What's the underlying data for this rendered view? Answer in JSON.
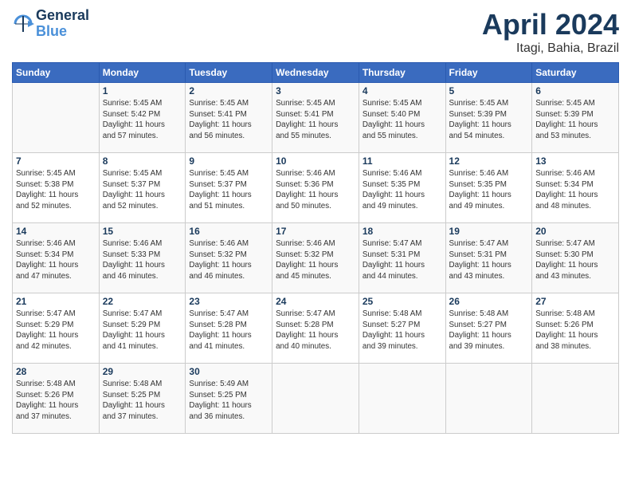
{
  "header": {
    "logo_line1": "General",
    "logo_line2": "Blue",
    "title": "April 2024",
    "subtitle": "Itagi, Bahia, Brazil"
  },
  "calendar": {
    "days_of_week": [
      "Sunday",
      "Monday",
      "Tuesday",
      "Wednesday",
      "Thursday",
      "Friday",
      "Saturday"
    ],
    "weeks": [
      [
        {
          "day": "",
          "info": ""
        },
        {
          "day": "1",
          "info": "Sunrise: 5:45 AM\nSunset: 5:42 PM\nDaylight: 11 hours\nand 57 minutes."
        },
        {
          "day": "2",
          "info": "Sunrise: 5:45 AM\nSunset: 5:41 PM\nDaylight: 11 hours\nand 56 minutes."
        },
        {
          "day": "3",
          "info": "Sunrise: 5:45 AM\nSunset: 5:41 PM\nDaylight: 11 hours\nand 55 minutes."
        },
        {
          "day": "4",
          "info": "Sunrise: 5:45 AM\nSunset: 5:40 PM\nDaylight: 11 hours\nand 55 minutes."
        },
        {
          "day": "5",
          "info": "Sunrise: 5:45 AM\nSunset: 5:39 PM\nDaylight: 11 hours\nand 54 minutes."
        },
        {
          "day": "6",
          "info": "Sunrise: 5:45 AM\nSunset: 5:39 PM\nDaylight: 11 hours\nand 53 minutes."
        }
      ],
      [
        {
          "day": "7",
          "info": "Sunrise: 5:45 AM\nSunset: 5:38 PM\nDaylight: 11 hours\nand 52 minutes."
        },
        {
          "day": "8",
          "info": "Sunrise: 5:45 AM\nSunset: 5:37 PM\nDaylight: 11 hours\nand 52 minutes."
        },
        {
          "day": "9",
          "info": "Sunrise: 5:45 AM\nSunset: 5:37 PM\nDaylight: 11 hours\nand 51 minutes."
        },
        {
          "day": "10",
          "info": "Sunrise: 5:46 AM\nSunset: 5:36 PM\nDaylight: 11 hours\nand 50 minutes."
        },
        {
          "day": "11",
          "info": "Sunrise: 5:46 AM\nSunset: 5:35 PM\nDaylight: 11 hours\nand 49 minutes."
        },
        {
          "day": "12",
          "info": "Sunrise: 5:46 AM\nSunset: 5:35 PM\nDaylight: 11 hours\nand 49 minutes."
        },
        {
          "day": "13",
          "info": "Sunrise: 5:46 AM\nSunset: 5:34 PM\nDaylight: 11 hours\nand 48 minutes."
        }
      ],
      [
        {
          "day": "14",
          "info": "Sunrise: 5:46 AM\nSunset: 5:34 PM\nDaylight: 11 hours\nand 47 minutes."
        },
        {
          "day": "15",
          "info": "Sunrise: 5:46 AM\nSunset: 5:33 PM\nDaylight: 11 hours\nand 46 minutes."
        },
        {
          "day": "16",
          "info": "Sunrise: 5:46 AM\nSunset: 5:32 PM\nDaylight: 11 hours\nand 46 minutes."
        },
        {
          "day": "17",
          "info": "Sunrise: 5:46 AM\nSunset: 5:32 PM\nDaylight: 11 hours\nand 45 minutes."
        },
        {
          "day": "18",
          "info": "Sunrise: 5:47 AM\nSunset: 5:31 PM\nDaylight: 11 hours\nand 44 minutes."
        },
        {
          "day": "19",
          "info": "Sunrise: 5:47 AM\nSunset: 5:31 PM\nDaylight: 11 hours\nand 43 minutes."
        },
        {
          "day": "20",
          "info": "Sunrise: 5:47 AM\nSunset: 5:30 PM\nDaylight: 11 hours\nand 43 minutes."
        }
      ],
      [
        {
          "day": "21",
          "info": "Sunrise: 5:47 AM\nSunset: 5:29 PM\nDaylight: 11 hours\nand 42 minutes."
        },
        {
          "day": "22",
          "info": "Sunrise: 5:47 AM\nSunset: 5:29 PM\nDaylight: 11 hours\nand 41 minutes."
        },
        {
          "day": "23",
          "info": "Sunrise: 5:47 AM\nSunset: 5:28 PM\nDaylight: 11 hours\nand 41 minutes."
        },
        {
          "day": "24",
          "info": "Sunrise: 5:47 AM\nSunset: 5:28 PM\nDaylight: 11 hours\nand 40 minutes."
        },
        {
          "day": "25",
          "info": "Sunrise: 5:48 AM\nSunset: 5:27 PM\nDaylight: 11 hours\nand 39 minutes."
        },
        {
          "day": "26",
          "info": "Sunrise: 5:48 AM\nSunset: 5:27 PM\nDaylight: 11 hours\nand 39 minutes."
        },
        {
          "day": "27",
          "info": "Sunrise: 5:48 AM\nSunset: 5:26 PM\nDaylight: 11 hours\nand 38 minutes."
        }
      ],
      [
        {
          "day": "28",
          "info": "Sunrise: 5:48 AM\nSunset: 5:26 PM\nDaylight: 11 hours\nand 37 minutes."
        },
        {
          "day": "29",
          "info": "Sunrise: 5:48 AM\nSunset: 5:25 PM\nDaylight: 11 hours\nand 37 minutes."
        },
        {
          "day": "30",
          "info": "Sunrise: 5:49 AM\nSunset: 5:25 PM\nDaylight: 11 hours\nand 36 minutes."
        },
        {
          "day": "",
          "info": ""
        },
        {
          "day": "",
          "info": ""
        },
        {
          "day": "",
          "info": ""
        },
        {
          "day": "",
          "info": ""
        }
      ]
    ]
  }
}
